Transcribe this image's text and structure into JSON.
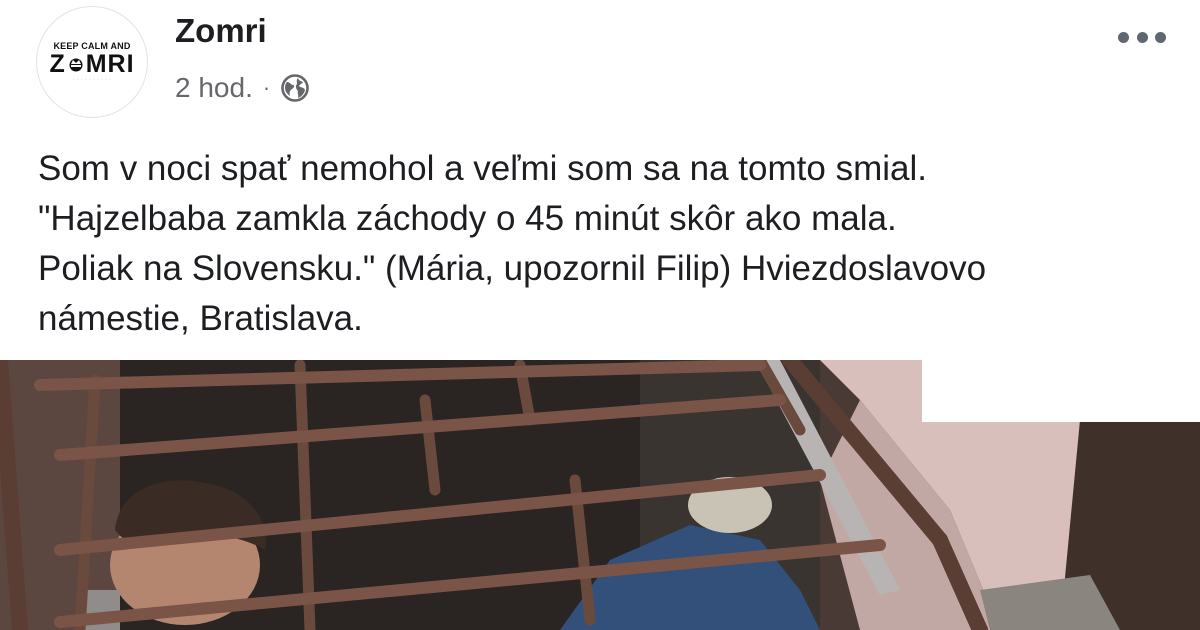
{
  "post": {
    "author": {
      "name": "Zomri",
      "avatar_top_text": "KEEP CALM AND",
      "avatar_main_text_left": "Z",
      "avatar_main_text_right": "MRI"
    },
    "meta": {
      "time": "2 hod.",
      "separator": "·",
      "audience_icon": "globe-icon"
    },
    "more_icon": "more-dots-icon",
    "text_lines": [
      "Som v noci spať nemohol a veľmi som sa na tomto smial.",
      "\"Hajzelbaba zamkla záchody o 45 minút skôr ako mala.",
      "Poliak na Slovensku.\" (Mária, upozornil Filip) Hviezdoslavovo",
      "námestie, Bratislava."
    ],
    "photo": {
      "subject": "man-behind-metal-grate-photo"
    }
  },
  "colors": {
    "name": "#1c1e21",
    "meta": "#65676b",
    "background": "#ffffff",
    "grate": "#6b4a3e"
  }
}
